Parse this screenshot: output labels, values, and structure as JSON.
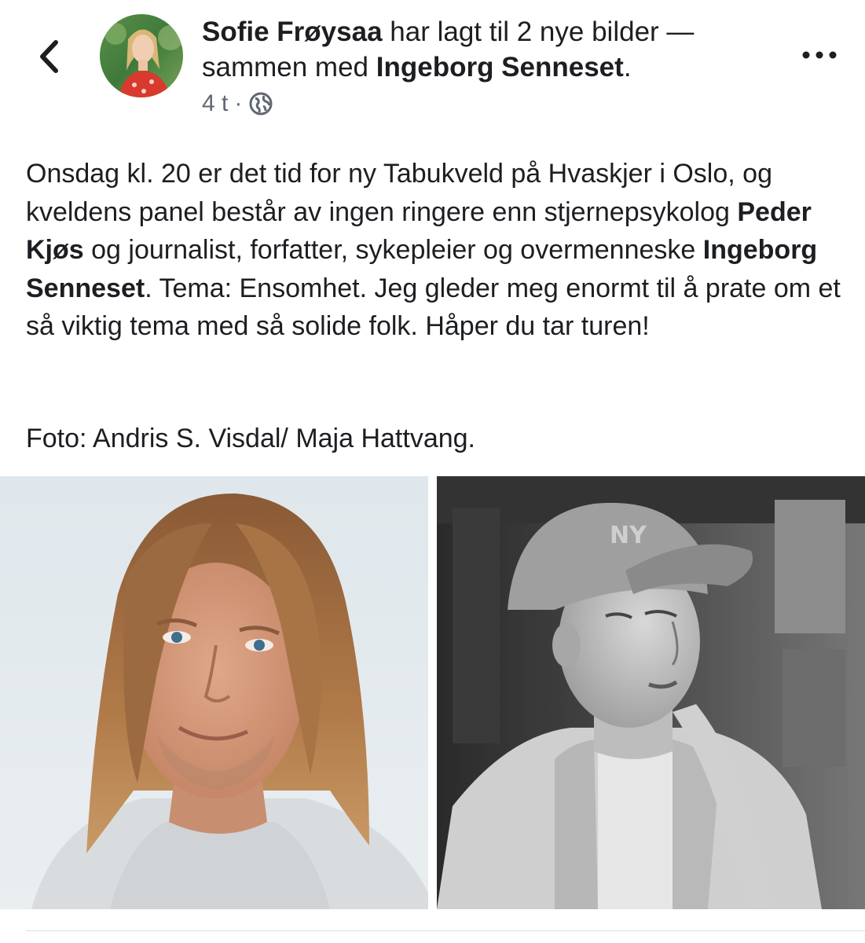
{
  "header": {
    "author_name": "Sofie Frøysaa",
    "action_text": " har lagt til 2 nye bilder — sammen med ",
    "tagged_name": "Ingeborg Senneset",
    "tagged_suffix": ".",
    "time": "4 t",
    "separator": "·",
    "audience_icon": "globe-icon",
    "back_icon": "chevron-left-icon",
    "more_icon": "more-horizontal-icon"
  },
  "post": {
    "segments": [
      {
        "text": "Onsdag kl. 20 er det tid for ny Tabukveld på Hvaskjer i Oslo, og kveldens panel består av ingen ringere enn stjernepsykolog ",
        "bold": false
      },
      {
        "text": "Peder Kjøs",
        "bold": true
      },
      {
        "text": " og journalist, forfatter, sykepleier og overmenneske ",
        "bold": false
      },
      {
        "text": "Ingeborg Senneset",
        "bold": true
      },
      {
        "text": ". Tema: Ensomhet. Jeg gleder meg enormt til å prate om et så viktig tema med så solide folk. Håper du tar turen!",
        "bold": false
      }
    ],
    "caption": "Foto: Andris S. Visdal/ Maja Hattvang."
  },
  "photos": [
    {
      "label": "photo-man-long-hair"
    },
    {
      "label": "photo-woman-cap-bw"
    }
  ],
  "colors": {
    "text": "#1c1e21",
    "meta": "#606770",
    "divider": "#dadde1"
  }
}
